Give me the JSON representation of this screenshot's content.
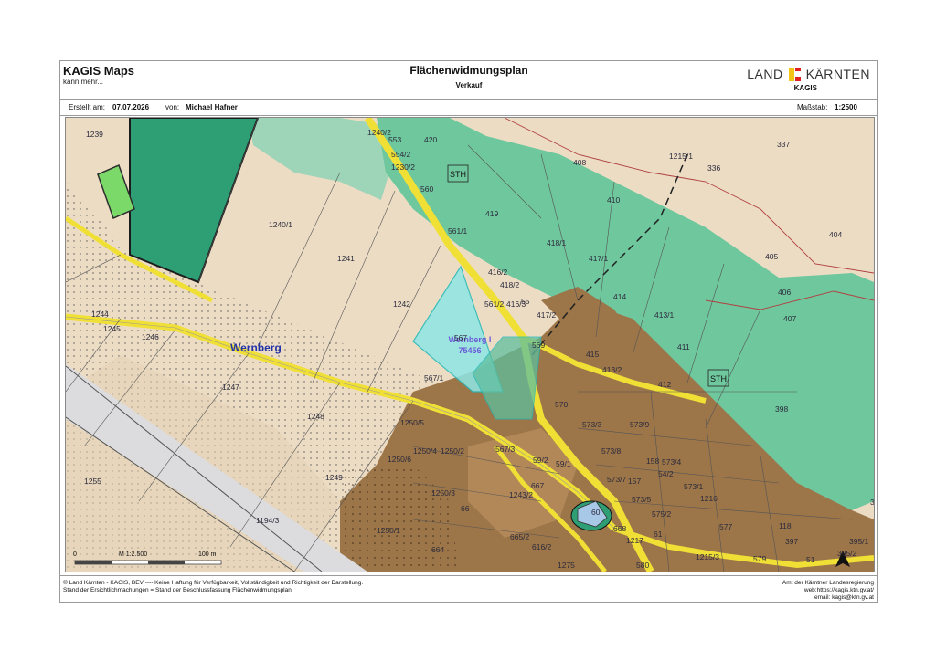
{
  "header": {
    "brand": "KAGIS Maps",
    "tagline": "kann mehr...",
    "title": "Flächenwidmungsplan",
    "subtitle": "Verkauf",
    "logo_left": "LAND",
    "logo_right": "KÄRNTEN",
    "logo_sub": "KAGIS"
  },
  "info": {
    "created_label": "Erstellt am:",
    "created_value": "07.07.2026",
    "by_label": "von:",
    "by_value": "Michael Hafner",
    "scale_label": "Maßstab:",
    "scale_value": "1:2500"
  },
  "map": {
    "place_label": "Wernberg",
    "selected_parcel_line1": "Wernberg I",
    "selected_parcel_line2": "75456",
    "selected_parcel_overlay": "567",
    "sth_labels": [
      "STH",
      "STH"
    ],
    "parcels": [
      "1239",
      "1240/2",
      "553",
      "554/2",
      "1230/2",
      "420",
      "408",
      "1215/1",
      "336",
      "337",
      "560",
      "410",
      "419",
      "561/1",
      "418/1",
      "417/1",
      "404",
      "405",
      "1240/1",
      "1241",
      "416/2",
      "418/2",
      "561/2",
      "416/3",
      "55",
      "417/2",
      "414",
      "413/1",
      "406",
      "407",
      "1242",
      "1244",
      "1245",
      "1246",
      "569",
      "415",
      "411",
      "413/2",
      "412",
      "398",
      "1247",
      "567/1",
      "570",
      "573/3",
      "573/9",
      "1248",
      "1250/5",
      "567/3",
      "573/8",
      "1250/4",
      "1250/2",
      "59/2",
      "59/1",
      "158",
      "573/4",
      "54/2",
      "1250/6",
      "573/7",
      "157",
      "573/1",
      "1255",
      "1249",
      "667",
      "573/5",
      "1216",
      "396",
      "1250/3",
      "1243/2",
      "60",
      "575/2",
      "1194/3",
      "66",
      "668",
      "61",
      "577",
      "118",
      "1250/1",
      "665/2",
      "1217",
      "397",
      "395/1",
      "664",
      "616/2",
      "1215/3",
      "579",
      "51",
      "395/2",
      "1275",
      "580"
    ],
    "scale_bar": {
      "zero": "0",
      "mid": "M 1:2.500",
      "end": "100 m"
    },
    "colors": {
      "forest": "#6fc79e",
      "forest_dark": "#2e9e75",
      "agriculture": "#ecdcc4",
      "building": "#9c7549",
      "road": "#f0e036",
      "railway": "#dcdcde",
      "selected": "#8ee6e6",
      "water": "#a8c8e8"
    }
  },
  "footer": {
    "line1": "© Land Kärnten - KAGIS, BEV ---- Keine Haftung für Verfügbarkeit, Vollständigkeit und Richtigkeit der Darstellung.",
    "line2": "Stand der Ersichtlichmachungen = Stand der Beschlussfassung Flächenwidmungsplan",
    "right1": "Amt der Kärntner Landesregierung",
    "right2": "web:https://kagis.ktn.gv.at/",
    "right3": "email: kagis@ktn.gv.at"
  }
}
